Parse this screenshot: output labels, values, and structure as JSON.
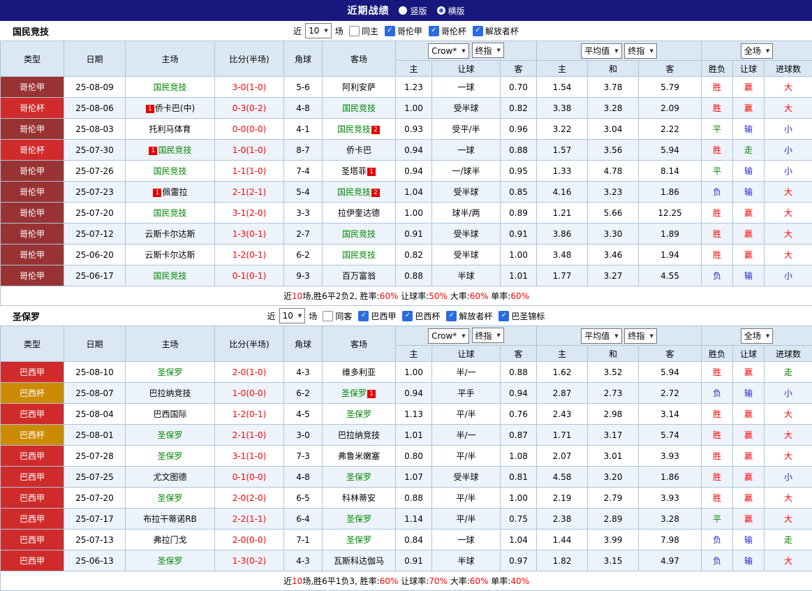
{
  "topbar": {
    "title": "近期战绩",
    "options": [
      {
        "label": "竖版",
        "selected": false
      },
      {
        "label": "横版",
        "selected": true
      }
    ]
  },
  "league_colors": {
    "哥伦甲": "#993333",
    "哥伦杯": "#cf2b2b",
    "巴西甲": "#cf2b2b",
    "巴西杯": "#cc8a00"
  },
  "status_colors": {
    "r": "#ff0000",
    "b": "#2424d0",
    "g": "#008800"
  },
  "sections": [
    {
      "team": "国民竞技",
      "filter": {
        "near_label": "近",
        "count": "10",
        "games_label": "场",
        "checkboxes": [
          {
            "label": "同主",
            "checked": false
          },
          {
            "label": "哥伦甲",
            "checked": true
          },
          {
            "label": "哥伦杯",
            "checked": true
          },
          {
            "label": "解放者杯",
            "checked": true
          }
        ]
      },
      "header": {
        "type": "类型",
        "date": "日期",
        "home": "主场",
        "score": "比分(半场)",
        "corner": "角球",
        "away": "客场",
        "odds_source": "Crow*",
        "odds_final": "终指",
        "avg_label": "平均值",
        "avg_final": "终指",
        "scope": "全场",
        "cols2": [
          "主",
          "让球",
          "客",
          "主",
          "和",
          "客",
          "胜负",
          "让球",
          "进球数"
        ]
      },
      "rows": [
        {
          "league": "哥伦甲",
          "date": "25-08-09",
          "home": {
            "name": "国民竞技",
            "focal": true
          },
          "score": "3-0(1-0)",
          "corner": "5-6",
          "away": {
            "name": "阿利安萨"
          },
          "odds": [
            "1.23",
            "一球",
            "0.70"
          ],
          "avg": [
            "1.54",
            "3.78",
            "5.79"
          ],
          "result": {
            "t": "胜",
            "c": "r"
          },
          "handicap": {
            "t": "赢",
            "c": "r"
          },
          "goals": {
            "t": "大",
            "c": "r"
          }
        },
        {
          "league": "哥伦杯",
          "date": "25-08-06",
          "home": {
            "name": "侨卡巴(中)",
            "badge_pre": "1"
          },
          "score": "0-3(0-2)",
          "corner": "4-8",
          "away": {
            "name": "国民竞技",
            "focal": true
          },
          "odds": [
            "1.00",
            "受半球",
            "0.82"
          ],
          "avg": [
            "3.38",
            "3.28",
            "2.09"
          ],
          "result": {
            "t": "胜",
            "c": "r"
          },
          "handicap": {
            "t": "赢",
            "c": "r"
          },
          "goals": {
            "t": "大",
            "c": "r"
          }
        },
        {
          "league": "哥伦甲",
          "date": "25-08-03",
          "home": {
            "name": "托利马体育"
          },
          "score": "0-0(0-0)",
          "corner": "4-1",
          "away": {
            "name": "国民竞技",
            "focal": true,
            "badge_post": "2"
          },
          "odds": [
            "0.93",
            "受平/半",
            "0.96"
          ],
          "avg": [
            "3.22",
            "3.04",
            "2.22"
          ],
          "result": {
            "t": "平",
            "c": "g"
          },
          "handicap": {
            "t": "输",
            "c": "b"
          },
          "goals": {
            "t": "小",
            "c": "b"
          }
        },
        {
          "league": "哥伦杯",
          "date": "25-07-30",
          "home": {
            "name": "国民竞技",
            "focal": true,
            "badge_pre": "1"
          },
          "score": "1-0(1-0)",
          "corner": "8-7",
          "away": {
            "name": "侨卡巴"
          },
          "odds": [
            "0.94",
            "一球",
            "0.88"
          ],
          "avg": [
            "1.57",
            "3.56",
            "5.94"
          ],
          "result": {
            "t": "胜",
            "c": "r"
          },
          "handicap": {
            "t": "走",
            "c": "g"
          },
          "goals": {
            "t": "小",
            "c": "b"
          }
        },
        {
          "league": "哥伦甲",
          "date": "25-07-26",
          "home": {
            "name": "国民竞技",
            "focal": true
          },
          "score": "1-1(1-0)",
          "corner": "7-4",
          "away": {
            "name": "圣塔菲",
            "badge_post": "1"
          },
          "odds": [
            "0.94",
            "一/球半",
            "0.95"
          ],
          "avg": [
            "1.33",
            "4.78",
            "8.14"
          ],
          "result": {
            "t": "平",
            "c": "g"
          },
          "handicap": {
            "t": "输",
            "c": "b"
          },
          "goals": {
            "t": "小",
            "c": "b"
          }
        },
        {
          "league": "哥伦甲",
          "date": "25-07-23",
          "home": {
            "name": "佩雷拉",
            "badge_pre": "1"
          },
          "score": "2-1(2-1)",
          "corner": "5-4",
          "away": {
            "name": "国民竞技",
            "focal": true,
            "badge_post": "2"
          },
          "odds": [
            "1.04",
            "受半球",
            "0.85"
          ],
          "avg": [
            "4.16",
            "3.23",
            "1.86"
          ],
          "result": {
            "t": "负",
            "c": "b"
          },
          "handicap": {
            "t": "输",
            "c": "b"
          },
          "goals": {
            "t": "大",
            "c": "r"
          }
        },
        {
          "league": "哥伦甲",
          "date": "25-07-20",
          "home": {
            "name": "国民竞技",
            "focal": true
          },
          "score": "3-1(2-0)",
          "corner": "3-3",
          "away": {
            "name": "拉伊奎达德"
          },
          "odds": [
            "1.00",
            "球半/两",
            "0.89"
          ],
          "avg": [
            "1.21",
            "5.66",
            "12.25"
          ],
          "result": {
            "t": "胜",
            "c": "r"
          },
          "handicap": {
            "t": "赢",
            "c": "r"
          },
          "goals": {
            "t": "大",
            "c": "r"
          }
        },
        {
          "league": "哥伦甲",
          "date": "25-07-12",
          "home": {
            "name": "云斯卡尔达斯"
          },
          "score": "1-3(0-1)",
          "corner": "2-7",
          "away": {
            "name": "国民竞技",
            "focal": true
          },
          "odds": [
            "0.91",
            "受半球",
            "0.91"
          ],
          "avg": [
            "3.86",
            "3.30",
            "1.89"
          ],
          "result": {
            "t": "胜",
            "c": "r"
          },
          "handicap": {
            "t": "赢",
            "c": "r"
          },
          "goals": {
            "t": "大",
            "c": "r"
          }
        },
        {
          "league": "哥伦甲",
          "date": "25-06-20",
          "home": {
            "name": "云斯卡尔达斯"
          },
          "score": "1-2(0-1)",
          "corner": "6-2",
          "away": {
            "name": "国民竞技",
            "focal": true
          },
          "odds": [
            "0.82",
            "受半球",
            "1.00"
          ],
          "avg": [
            "3.48",
            "3.46",
            "1.94"
          ],
          "result": {
            "t": "胜",
            "c": "r"
          },
          "handicap": {
            "t": "赢",
            "c": "r"
          },
          "goals": {
            "t": "大",
            "c": "r"
          }
        },
        {
          "league": "哥伦甲",
          "date": "25-06-17",
          "home": {
            "name": "国民竞技",
            "focal": true
          },
          "score": "0-1(0-1)",
          "corner": "9-3",
          "away": {
            "name": "百万富翁"
          },
          "odds": [
            "0.88",
            "半球",
            "1.01"
          ],
          "avg": [
            "1.77",
            "3.27",
            "4.55"
          ],
          "result": {
            "t": "负",
            "c": "b"
          },
          "handicap": {
            "t": "输",
            "c": "b"
          },
          "goals": {
            "t": "小",
            "c": "b"
          }
        }
      ],
      "summary": [
        {
          "t": "近",
          "c": "k"
        },
        {
          "t": "10",
          "c": "r"
        },
        {
          "t": "场,胜6平2负2, 胜率:",
          "c": "k"
        },
        {
          "t": "60%",
          "c": "r"
        },
        {
          "t": " 让球率:",
          "c": "k"
        },
        {
          "t": "50%",
          "c": "r"
        },
        {
          "t": " 大率:",
          "c": "k"
        },
        {
          "t": "60%",
          "c": "r"
        },
        {
          "t": " 单率:",
          "c": "k"
        },
        {
          "t": "60%",
          "c": "r"
        }
      ]
    },
    {
      "team": "圣保罗",
      "filter": {
        "near_label": "近",
        "count": "10",
        "games_label": "场",
        "checkboxes": [
          {
            "label": "同客",
            "checked": false
          },
          {
            "label": "巴西甲",
            "checked": true
          },
          {
            "label": "巴西杯",
            "checked": true
          },
          {
            "label": "解放者杯",
            "checked": true
          },
          {
            "label": "巴圣锦标",
            "checked": true
          }
        ]
      },
      "header": {
        "type": "类型",
        "date": "日期",
        "home": "主场",
        "score": "比分(半场)",
        "corner": "角球",
        "away": "客场",
        "odds_source": "Crow*",
        "odds_final": "终指",
        "avg_label": "平均值",
        "avg_final": "终指",
        "scope": "全场",
        "cols2": [
          "主",
          "让球",
          "客",
          "主",
          "和",
          "客",
          "胜负",
          "让球",
          "进球数"
        ]
      },
      "rows": [
        {
          "league": "巴西甲",
          "date": "25-08-10",
          "home": {
            "name": "圣保罗",
            "focal": true
          },
          "score": "2-0(1-0)",
          "corner": "4-3",
          "away": {
            "name": "维多利亚"
          },
          "odds": [
            "1.00",
            "半/一",
            "0.88"
          ],
          "avg": [
            "1.62",
            "3.52",
            "5.94"
          ],
          "result": {
            "t": "胜",
            "c": "r"
          },
          "handicap": {
            "t": "赢",
            "c": "r"
          },
          "goals": {
            "t": "走",
            "c": "g"
          }
        },
        {
          "league": "巴西杯",
          "date": "25-08-07",
          "home": {
            "name": "巴拉纳竞技"
          },
          "score": "1-0(0-0)",
          "corner": "6-2",
          "away": {
            "name": "圣保罗",
            "focal": true,
            "badge_post": "1"
          },
          "odds": [
            "0.94",
            "平手",
            "0.94"
          ],
          "avg": [
            "2.87",
            "2.73",
            "2.72"
          ],
          "result": {
            "t": "负",
            "c": "b"
          },
          "handicap": {
            "t": "输",
            "c": "b"
          },
          "goals": {
            "t": "小",
            "c": "b"
          }
        },
        {
          "league": "巴西甲",
          "date": "25-08-04",
          "home": {
            "name": "巴西国际"
          },
          "score": "1-2(0-1)",
          "corner": "4-5",
          "away": {
            "name": "圣保罗",
            "focal": true
          },
          "odds": [
            "1.13",
            "平/半",
            "0.76"
          ],
          "avg": [
            "2.43",
            "2.98",
            "3.14"
          ],
          "result": {
            "t": "胜",
            "c": "r"
          },
          "handicap": {
            "t": "赢",
            "c": "r"
          },
          "goals": {
            "t": "大",
            "c": "r"
          }
        },
        {
          "league": "巴西杯",
          "date": "25-08-01",
          "home": {
            "name": "圣保罗",
            "focal": true
          },
          "score": "2-1(1-0)",
          "corner": "3-0",
          "away": {
            "name": "巴拉纳竞技"
          },
          "odds": [
            "1.01",
            "半/一",
            "0.87"
          ],
          "avg": [
            "1.71",
            "3.17",
            "5.74"
          ],
          "result": {
            "t": "胜",
            "c": "r"
          },
          "handicap": {
            "t": "赢",
            "c": "r"
          },
          "goals": {
            "t": "大",
            "c": "r"
          }
        },
        {
          "league": "巴西甲",
          "date": "25-07-28",
          "home": {
            "name": "圣保罗",
            "focal": true
          },
          "score": "3-1(1-0)",
          "corner": "7-3",
          "away": {
            "name": "弗鲁米嫩塞"
          },
          "odds": [
            "0.80",
            "平/半",
            "1.08"
          ],
          "avg": [
            "2.07",
            "3.01",
            "3.93"
          ],
          "result": {
            "t": "胜",
            "c": "r"
          },
          "handicap": {
            "t": "赢",
            "c": "r"
          },
          "goals": {
            "t": "大",
            "c": "r"
          }
        },
        {
          "league": "巴西甲",
          "date": "25-07-25",
          "home": {
            "name": "尤文图德"
          },
          "score": "0-1(0-0)",
          "corner": "4-8",
          "away": {
            "name": "圣保罗",
            "focal": true
          },
          "odds": [
            "1.07",
            "受半球",
            "0.81"
          ],
          "avg": [
            "4.58",
            "3.20",
            "1.86"
          ],
          "result": {
            "t": "胜",
            "c": "r"
          },
          "handicap": {
            "t": "赢",
            "c": "r"
          },
          "goals": {
            "t": "小",
            "c": "b"
          }
        },
        {
          "league": "巴西甲",
          "date": "25-07-20",
          "home": {
            "name": "圣保罗",
            "focal": true
          },
          "score": "2-0(2-0)",
          "corner": "6-5",
          "away": {
            "name": "科林蒂安"
          },
          "odds": [
            "0.88",
            "平/半",
            "1.00"
          ],
          "avg": [
            "2.19",
            "2.79",
            "3.93"
          ],
          "result": {
            "t": "胜",
            "c": "r"
          },
          "handicap": {
            "t": "赢",
            "c": "r"
          },
          "goals": {
            "t": "大",
            "c": "r"
          }
        },
        {
          "league": "巴西甲",
          "date": "25-07-17",
          "home": {
            "name": "布拉干蒂诺RB"
          },
          "score": "2-2(1-1)",
          "corner": "6-4",
          "away": {
            "name": "圣保罗",
            "focal": true
          },
          "odds": [
            "1.14",
            "平/半",
            "0.75"
          ],
          "avg": [
            "2.38",
            "2.89",
            "3.28"
          ],
          "result": {
            "t": "平",
            "c": "g"
          },
          "handicap": {
            "t": "赢",
            "c": "r"
          },
          "goals": {
            "t": "大",
            "c": "r"
          }
        },
        {
          "league": "巴西甲",
          "date": "25-07-13",
          "home": {
            "name": "弗拉门戈"
          },
          "score": "2-0(0-0)",
          "corner": "7-1",
          "away": {
            "name": "圣保罗",
            "focal": true
          },
          "odds": [
            "0.84",
            "一球",
            "1.04"
          ],
          "avg": [
            "1.44",
            "3.99",
            "7.98"
          ],
          "result": {
            "t": "负",
            "c": "b"
          },
          "handicap": {
            "t": "输",
            "c": "b"
          },
          "goals": {
            "t": "走",
            "c": "g"
          }
        },
        {
          "league": "巴西甲",
          "date": "25-06-13",
          "home": {
            "name": "圣保罗",
            "focal": true
          },
          "score": "1-3(0-2)",
          "corner": "4-3",
          "away": {
            "name": "瓦斯科达伽马"
          },
          "odds": [
            "0.91",
            "半球",
            "0.97"
          ],
          "avg": [
            "1.82",
            "3.15",
            "4.97"
          ],
          "result": {
            "t": "负",
            "c": "b"
          },
          "handicap": {
            "t": "输",
            "c": "b"
          },
          "goals": {
            "t": "大",
            "c": "r"
          }
        }
      ],
      "summary": [
        {
          "t": "近",
          "c": "k"
        },
        {
          "t": "10",
          "c": "r"
        },
        {
          "t": "场,胜6平1负3, 胜率:",
          "c": "k"
        },
        {
          "t": "60%",
          "c": "r"
        },
        {
          "t": " 让球率:",
          "c": "k"
        },
        {
          "t": "70%",
          "c": "r"
        },
        {
          "t": " 大率:",
          "c": "k"
        },
        {
          "t": "60%",
          "c": "r"
        },
        {
          "t": " 单率:",
          "c": "k"
        },
        {
          "t": "40%",
          "c": "r"
        }
      ]
    }
  ]
}
